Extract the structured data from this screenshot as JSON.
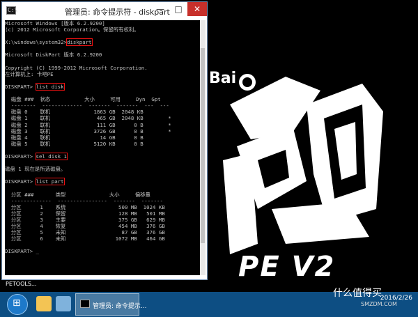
{
  "window": {
    "title": "管理员: 命令提示符 - diskpart",
    "min_label": "—",
    "max_label": "□",
    "close_label": "✕"
  },
  "console": {
    "l1": "Microsoft Windows [版本 6.2.9200]",
    "l2": "(c) 2012 Microsoft Corporation。保留所有权利。",
    "l3_prompt": "X:\\windows\\system32>",
    "l3_cmd": "diskpart",
    "l4": "Microsoft DiskPart 版本 6.2.9200",
    "l5": "Copyright (C) 1999-2012 Microsoft Corporation.",
    "l6": "在计算机上: 卡吧PE",
    "l7_prompt": "DISKPART> ",
    "l7_cmd": "list disk",
    "disk_header": "  磁盘 ###  状态           大小     可用     Dyn  Gpt",
    "disk_sep": "  --------  -------------  -------  -------  ---  ---",
    "disk_rows": [
      "  磁盘 0    联机              1863 GB  2048 KB",
      "  磁盘 1    联机               465 GB  2048 KB        *",
      "  磁盘 2    联机               111 GB      0 B        *",
      "  磁盘 3    联机              3726 GB      0 B        *",
      "  磁盘 4    联机                14 GB      0 B",
      "  磁盘 5    联机              5120 KB      0 B"
    ],
    "l8_prompt": "DISKPART> ",
    "l8_cmd": "sel disk 1",
    "l9": "磁盘 1 现在是所选磁盘。",
    "l10_prompt": "DISKPART> ",
    "l10_cmd": "list part",
    "part_header": "  分区 ###       类型              大小     偏移量",
    "part_sep": "  -------------  ----------------  -------  -------",
    "part_rows": [
      "  分区      1    系统                 500 MB  1024 KB",
      "  分区      2    保留                 128 MB   501 MB",
      "  分区      3    主要                 375 GB   629 MB",
      "  分区      4    恢复                 454 MB   376 GB",
      "  分区      5    未知                  87 GB   376 GB",
      "  分区      6    未知                1072 MB   464 GB"
    ],
    "l11_prompt": "DISKPART> _"
  },
  "desktop": {
    "logo_baidu": "Bai",
    "logo_du": "du",
    "logo_zh": "百度",
    "logo_title": "PE V2",
    "petools": "PETOOLS..."
  },
  "taskbar": {
    "app_label": "管理员: 命令提示...",
    "clock_time": "",
    "clock_date": "2016/2/26"
  },
  "watermark": {
    "text": "什么值得买",
    "sub": "SMZDM.COM"
  }
}
